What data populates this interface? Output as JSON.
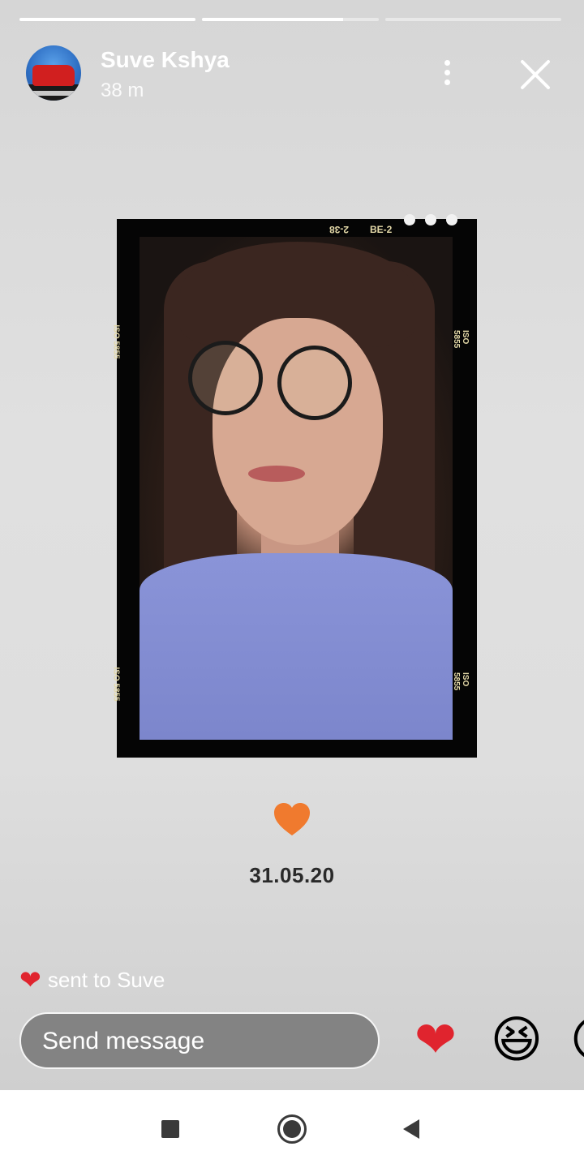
{
  "story": {
    "progress": [
      1.0,
      0.8,
      0.0
    ],
    "user": {
      "name": "Suve Kshya",
      "time_ago": "38 m"
    },
    "frame_text": {
      "top_left_code": "BE-2",
      "top_right_code": "2-38",
      "side_code": "ISO 5855"
    },
    "date_text": "31.05.20",
    "sticker_icon": "orange-heart-icon",
    "sent_status": "sent to Suve"
  },
  "reply": {
    "placeholder": "Send message"
  },
  "quick_reactions": [
    {
      "icon": "red-heart-emoji",
      "glyph": "❤"
    },
    {
      "icon": "grinning-squinting-emoji",
      "glyph": "😆"
    },
    {
      "icon": "partially-visible-emoji",
      "glyph": "😮"
    }
  ],
  "colors": {
    "accent_heart": "#e0242e",
    "sticker_heart": "#f07a2e",
    "reply_bar_bg": "#7a7a7a"
  },
  "nav": {
    "recent": "recent-apps-icon",
    "home": "home-icon",
    "back": "back-icon"
  }
}
